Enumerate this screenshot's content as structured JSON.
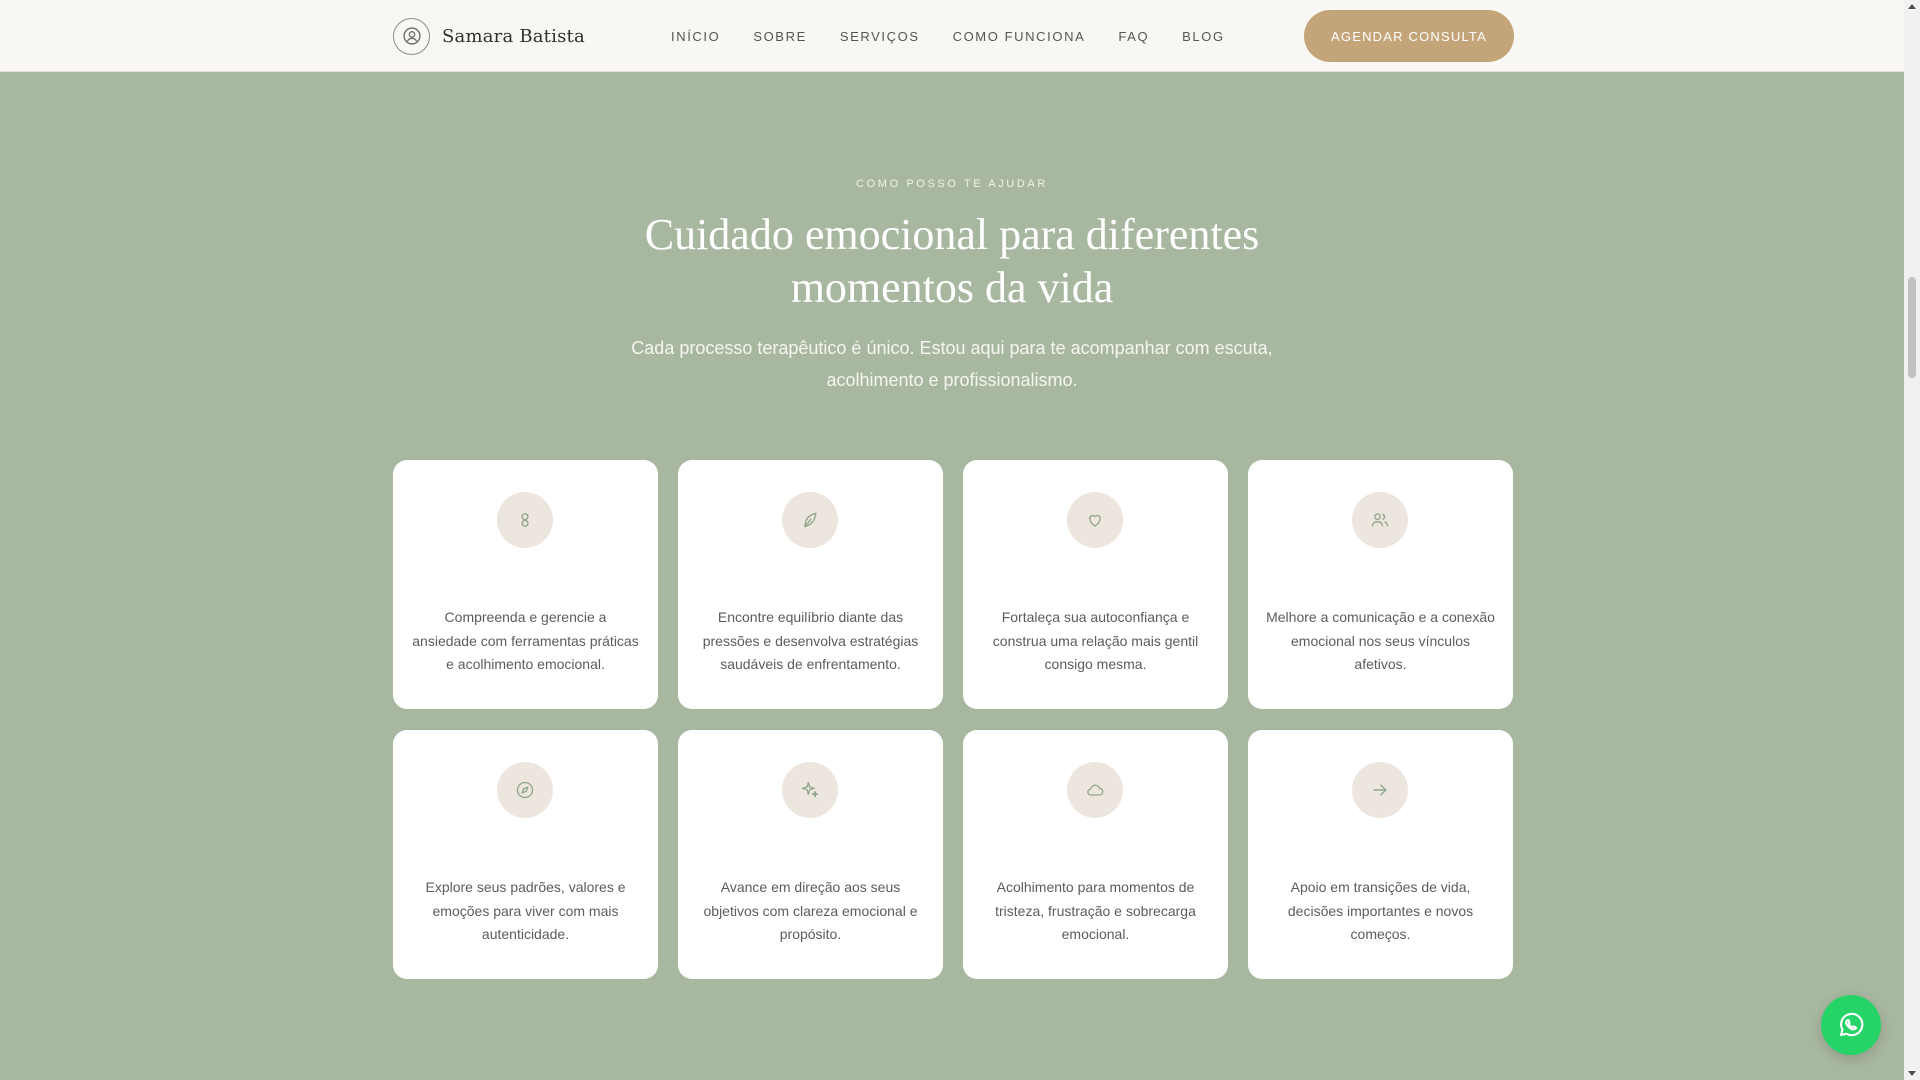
{
  "header": {
    "brand_name": "Samara Batista",
    "nav": [
      "INÍCIO",
      "SOBRE",
      "SERVIÇOS",
      "COMO FUNCIONA",
      "FAQ",
      "BLOG"
    ],
    "cta_label": "AGENDAR CONSULTA"
  },
  "section": {
    "eyebrow": "COMO POSSO TE AJUDAR",
    "title": "Cuidado emocional para diferentes momentos da vida",
    "subtitle": "Cada processo terapêutico é único. Estou aqui para te acompanhar com escuta, acolhimento e profissionalismo."
  },
  "cards": [
    {
      "icon": "brain-icon",
      "text": "Compreenda e gerencie a ansiedade com ferramentas práticas e acolhimento emocional."
    },
    {
      "icon": "leaf-icon",
      "text": "Encontre equilíbrio diante das pressões e desenvolva estratégias saudáveis de enfrentamento."
    },
    {
      "icon": "heart-icon",
      "text": "Fortaleça sua autoconfiança e construa uma relação mais gentil consigo mesma."
    },
    {
      "icon": "users-icon",
      "text": "Melhore a comunicação e a conexão emocional nos seus vínculos afetivos."
    },
    {
      "icon": "compass-icon",
      "text": "Explore seus padrões, valores e emoções para viver com mais autenticidade."
    },
    {
      "icon": "sparkles-icon",
      "text": "Avance em direção aos seus objetivos com clareza emocional e propósito."
    },
    {
      "icon": "cloud-icon",
      "text": "Acolhimento para momentos de tristeza, frustração e sobrecarga emocional."
    },
    {
      "icon": "arrow-right-icon",
      "text": "Apoio em transições de vida, decisões importantes e novos começos."
    }
  ],
  "colors": {
    "background": "#a8b7a0",
    "header_bg": "#f9f7f3",
    "accent": "#c4a57a",
    "icon_circle": "#ede6de",
    "icon_stroke": "#8fa68a",
    "whatsapp": "#25d366"
  },
  "floating": {
    "icon": "whatsapp-icon"
  }
}
